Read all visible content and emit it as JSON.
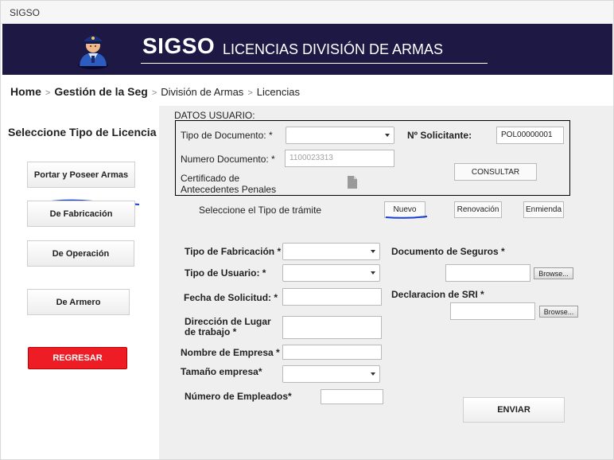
{
  "tab": {
    "title": "SIGSO"
  },
  "header": {
    "brand": "SIGSO",
    "subtitle": "LICENCIAS DIVISIÓN DE ARMAS",
    "avatar_icon": "police-officer-icon"
  },
  "breadcrumb": {
    "home": "Home",
    "item1": "Gestión de la Seg",
    "item2": "División de Armas",
    "item3": "Licencias",
    "separator": ">"
  },
  "left": {
    "title": "Seleccione Tipo de Licencia",
    "buttons": [
      "Portar y Poseer Armas",
      "De Fabricación",
      "De Operación",
      "De Armero"
    ],
    "back_button": "REGRESAR"
  },
  "datos": {
    "title": "DATOS USUARIO:",
    "tipo_doc_label": "Tipo de Documento: *",
    "tipo_doc_value": "",
    "num_doc_label": "Numero Documento: *",
    "num_doc_value": "1100023313",
    "cert_label_1": "Certificado de",
    "cert_label_2": "Antecedentes Penales",
    "cert_icon": "document-icon",
    "solicitante_label": "Nº Solicitante:",
    "solicitante_value": "POL00000001",
    "consultar": "CONSULTAR"
  },
  "tramite": {
    "label": "Seleccione el Tipo de trámite",
    "options": [
      "Nuevo",
      "Renovación",
      "Enmienda"
    ]
  },
  "form": {
    "tipo_fabricacion": "Tipo de Fabricación *",
    "tipo_usuario": "Tipo de Usuario: *",
    "fecha": "Fecha de Solicitud: *",
    "direccion_1": "Dirección de Lugar",
    "direccion_2": "de trabajo *",
    "empresa": "Nombre de Empresa *",
    "tamano": "Tamaño empresa*",
    "empleados": "Número de Empleados*",
    "seguros": "Documento de Seguros *",
    "sri": "Declaracion de SRI *",
    "browse": "Browse...",
    "enviar": "ENVIAR"
  },
  "colors": {
    "banner": "#1e1845",
    "panel": "#efefef",
    "danger": "#ee1c24",
    "annotation": "#1a3fd6"
  }
}
